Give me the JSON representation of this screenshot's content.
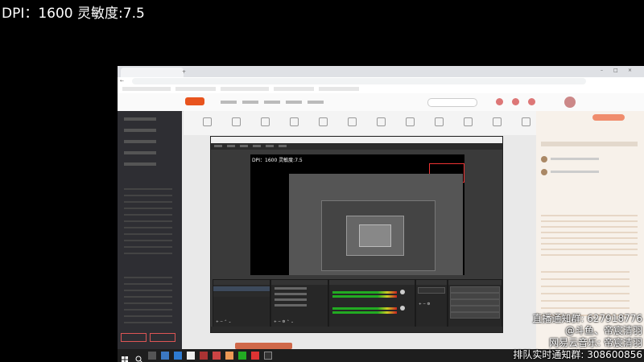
{
  "overlay": {
    "title": "DPI：1600 灵敏度:7.5"
  },
  "stream_overlay": {
    "lines": [
      "直播通知群: 627918776",
      "@斗鱼、帝宸清羽",
      "网易云音乐: 帝宸清羽",
      "排队实时通知群: 308600856"
    ]
  },
  "obs": {
    "preview_text": "DPI：1600 灵敏度:7.5"
  }
}
